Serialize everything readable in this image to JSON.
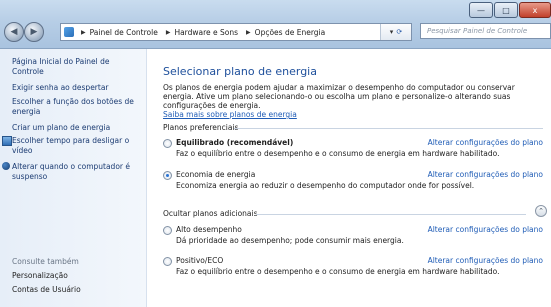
{
  "window": {
    "minimize_glyph": "—",
    "maximize_glyph": "□",
    "close_glyph": "x"
  },
  "address": {
    "crumbs": [
      "Painel de Controle",
      "Hardware e Sons",
      "Opções de Energia"
    ],
    "dropdown_glyph": "▾",
    "refresh_glyph": "⟳"
  },
  "search": {
    "placeholder": "Pesquisar Painel de Controle"
  },
  "left": {
    "items": [
      {
        "label": "Página Inicial do Painel de Controle"
      },
      {
        "label": "Exigir senha ao despertar"
      },
      {
        "label": "Escolher a função dos botões de energia"
      },
      {
        "label": "Criar um plano de energia"
      },
      {
        "label": "Escolher tempo para desligar o vídeo"
      },
      {
        "label": "Alterar quando o computador é suspenso"
      }
    ],
    "see_also": "Consulte também",
    "see_also_items": [
      {
        "label": "Personalização"
      },
      {
        "label": "Contas de Usuário"
      }
    ]
  },
  "main": {
    "title": "Selecionar plano de energia",
    "intro": "Os planos de energia podem ajudar a maximizar o desempenho do computador ou conservar energia. Ative um plano selecionando-o ou escolha um plano e personalize-o alterando suas configurações de energia.",
    "intro_link": "Saiba mais sobre planos de energia",
    "preferred_label": "Planos preferenciais",
    "hidden_label": "Ocultar planos adicionais",
    "change_link": "Alterar configurações do plano",
    "plans": [
      {
        "name": "Equilibrado (recomendável)",
        "desc": "Faz o equilíbrio entre o desempenho e o consumo de energia em hardware habilitado.",
        "selected": false
      },
      {
        "name": "Economia de energia",
        "desc": "Economiza energia ao reduzir o desempenho do computador onde for possível.",
        "selected": true
      },
      {
        "name": "Alto desempenho",
        "desc": "Dá prioridade ao desempenho; pode consumir mais energia.",
        "selected": false
      },
      {
        "name": "Positivo/ECO",
        "desc": "Faz o equilíbrio entre o desempenho e o consumo de energia em hardware habilitado.",
        "selected": false
      }
    ]
  },
  "colors": {
    "accent": "#1e4f9b",
    "link": "#1f5cb6"
  }
}
